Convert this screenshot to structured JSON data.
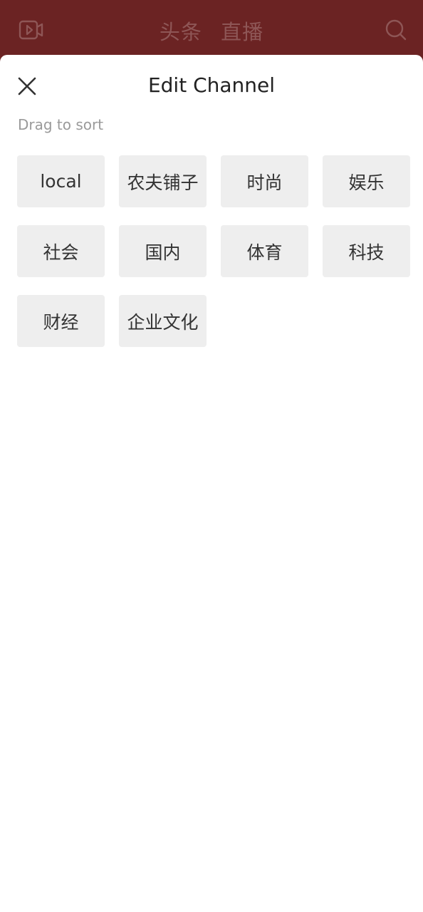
{
  "header": {
    "tabs": [
      "头条",
      "直播"
    ],
    "video_icon": "video-camera-icon",
    "search_icon": "search-icon"
  },
  "sheet": {
    "title": "Edit Channel",
    "hint": "Drag to sort",
    "close_icon": "close-icon"
  },
  "channels": [
    "local",
    "农夫铺子",
    "时尚",
    "娱乐",
    "社会",
    "国内",
    "体育",
    "科技",
    "财经",
    "企业文化"
  ],
  "colors": {
    "header_bg": "#6b2323",
    "header_text": "#8e5656",
    "chip_bg": "#eeeeee",
    "hint_text": "#9a9a9a"
  }
}
